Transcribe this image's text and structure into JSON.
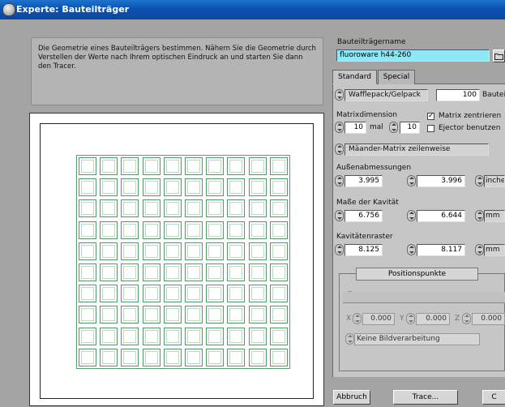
{
  "window": {
    "title": "Experte: Bauteilträger"
  },
  "description": {
    "text": "Die Geometrie eines Bauteilträgers bestimmen. Nähern Sie die Geometrie durch Verstellen der Werte nach Ihrem optischen Eindruck an und starten Sie dann den Tracer."
  },
  "preview": {
    "rows": 10,
    "cols": 10
  },
  "carrier": {
    "name_label": "Bauteilträgername",
    "name_value": "fluoroware h44-260"
  },
  "tabs": [
    {
      "label": "Standard"
    },
    {
      "label": "Special"
    }
  ],
  "standard": {
    "type_value": "Wafflepack/Gelpack",
    "part_count": "100",
    "part_unit": "Bauteile",
    "matrix_label": "Matrixdimension",
    "matrix_rows": "10",
    "matrix_times": "mal",
    "matrix_cols": "10",
    "center_label": "Matrix zentrieren",
    "center_checked": true,
    "ejector_label": "Ejector benutzen",
    "ejector_checked": false,
    "order_value": "Mäander-Matrix zeilenweise",
    "outer_label": "Außenabmessungen",
    "outer_x": "3.995",
    "outer_y": "3.996",
    "outer_unit": "inches",
    "cavity_label": "Maße der Kavität",
    "cavity_x": "6.756",
    "cavity_y": "6.644",
    "cavity_unit": "mm",
    "pitch_label": "Kavitätenraster",
    "pitch_x": "8.125",
    "pitch_y": "8.117",
    "pitch_unit": "mm"
  },
  "positions": {
    "title": "Positionspunkte",
    "x_label": "X",
    "x_value": "0.000",
    "y_label": "Y",
    "y_value": "0.000",
    "z_label": "Z",
    "z_value": "0.000",
    "image_processing": "Keine Bildverarbeitung"
  },
  "footer": {
    "cancel_label": "Abbruch",
    "trace_label": "Trace...",
    "partial_label": "C"
  }
}
